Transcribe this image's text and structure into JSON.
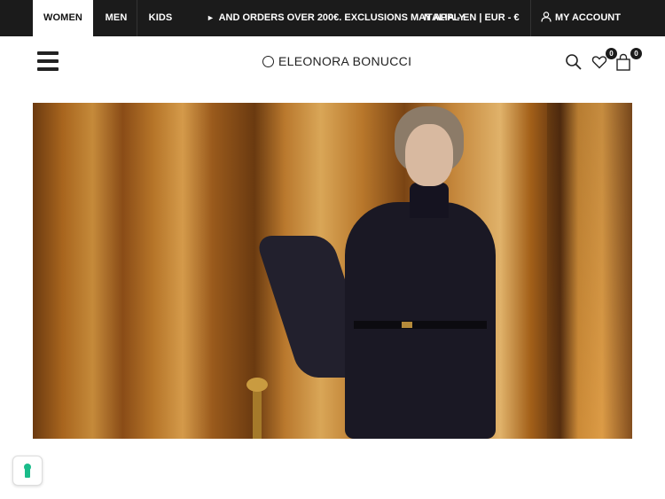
{
  "topbar": {
    "tabs": [
      {
        "label": "WOMEN",
        "active": true
      },
      {
        "label": "MEN",
        "active": false
      },
      {
        "label": "KIDS",
        "active": false
      }
    ],
    "ticker_text": "AND ORDERS OVER 200€. EXCLUSIONS MAY APPLY",
    "locale_text": "ITALIA - EN | EUR - €",
    "account_label": "MY ACCOUNT",
    "account_icon": "user-icon",
    "background_color": "#1b1b1b"
  },
  "header": {
    "menu_icon": "hamburger-menu-icon",
    "logo_text": "ELEONORA BONUCCI",
    "logo_icon": "circle-logo-icon",
    "search_icon": "search-icon",
    "wishlist_icon": "heart-icon",
    "wishlist_count": "0",
    "cart_icon": "shopping-bag-icon",
    "cart_count": "0"
  },
  "hero": {
    "image": "campaign-photo"
  },
  "privacy_widget": {
    "icon": "keyhole-icon",
    "accent_color": "#1abc8a"
  }
}
